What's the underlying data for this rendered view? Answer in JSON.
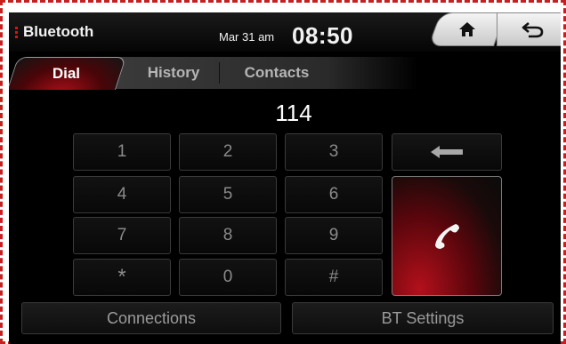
{
  "header": {
    "app_title": "Bluetooth",
    "date": "Mar 31 am",
    "time": "08:50"
  },
  "nav": {
    "home_icon": "home-icon",
    "back_icon": "back-arrow-icon"
  },
  "tabs": [
    {
      "label": "Dial",
      "active": true
    },
    {
      "label": "History",
      "active": false
    },
    {
      "label": "Contacts",
      "active": false
    }
  ],
  "dialer": {
    "number": "114",
    "keys": [
      "1",
      "2",
      "3",
      "4",
      "5",
      "6",
      "7",
      "8",
      "9",
      "*",
      "0",
      "#"
    ],
    "backspace_icon": "backspace-arrow-icon",
    "call_icon": "phone-handset-icon"
  },
  "bottom": {
    "connections_label": "Connections",
    "bt_settings_label": "BT Settings"
  },
  "colors": {
    "accent": "#b3101b",
    "border_highlight": "#c81e1e"
  }
}
